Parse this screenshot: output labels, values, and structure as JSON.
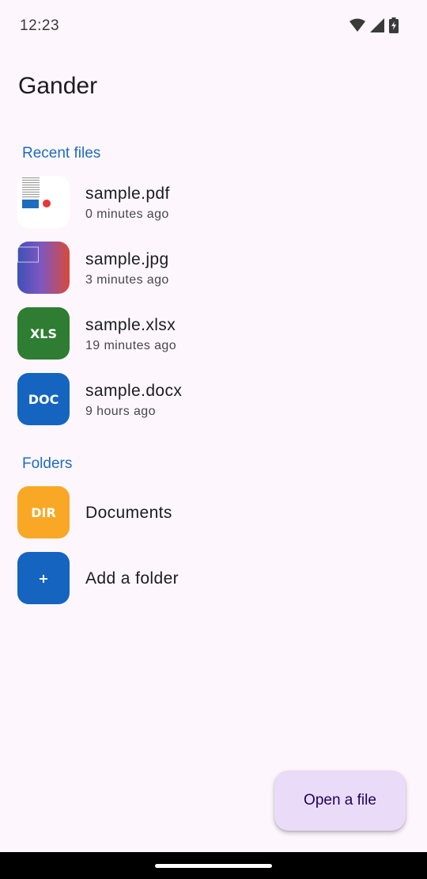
{
  "status_bar": {
    "time": "12:23",
    "icons": [
      "wifi-icon",
      "cell-signal-icon",
      "battery-charging-icon"
    ]
  },
  "app": {
    "title": "Gander"
  },
  "recent": {
    "header": "Recent files",
    "items": [
      {
        "name": "sample.pdf",
        "time": "0 minutes ago",
        "icon": "pdf-thumbnail"
      },
      {
        "name": "sample.jpg",
        "time": "3 minutes ago",
        "icon": "image-thumbnail"
      },
      {
        "name": "sample.xlsx",
        "time": "19 minutes ago",
        "icon_label": "XLS",
        "color": "#2e7d32"
      },
      {
        "name": "sample.docx",
        "time": "9 hours ago",
        "icon_label": "DOC",
        "color": "#1565c0"
      }
    ]
  },
  "folders": {
    "header": "Folders",
    "items": [
      {
        "name": "Documents",
        "icon_label": "DIR",
        "color": "#f9a825"
      },
      {
        "name": "Add a folder",
        "icon_label": "+",
        "color": "#1565c0"
      }
    ]
  },
  "fab": {
    "label": "Open a file"
  },
  "colors": {
    "background": "#fdf7fd",
    "accent": "#1e6cc0",
    "fab_background": "#eadcf8",
    "fab_text": "#21005d"
  }
}
